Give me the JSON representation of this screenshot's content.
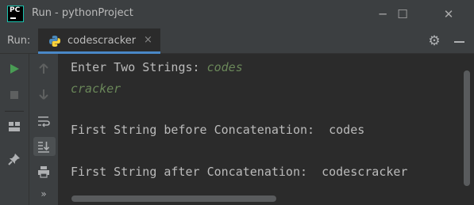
{
  "window": {
    "title": "Run - pythonProject",
    "minimize_glyph": "─",
    "maximize_glyph": "☐",
    "close_glyph": "✕"
  },
  "app_icon": {
    "text": "PC"
  },
  "run_panel": {
    "label": "Run:",
    "tab_label": "codescracker",
    "tab_close": "×"
  },
  "console": {
    "prompt": "Enter Two Strings: ",
    "input1": "codes",
    "input2": "cracker",
    "line_before": "First String before Concatenation:  codes",
    "line_after": "First String after Concatenation:  codescracker"
  },
  "colors": {
    "input_text": "#6a8759",
    "run_green": "#499c54",
    "tab_underline": "#4a88c7",
    "background": "#2b2b2b"
  }
}
